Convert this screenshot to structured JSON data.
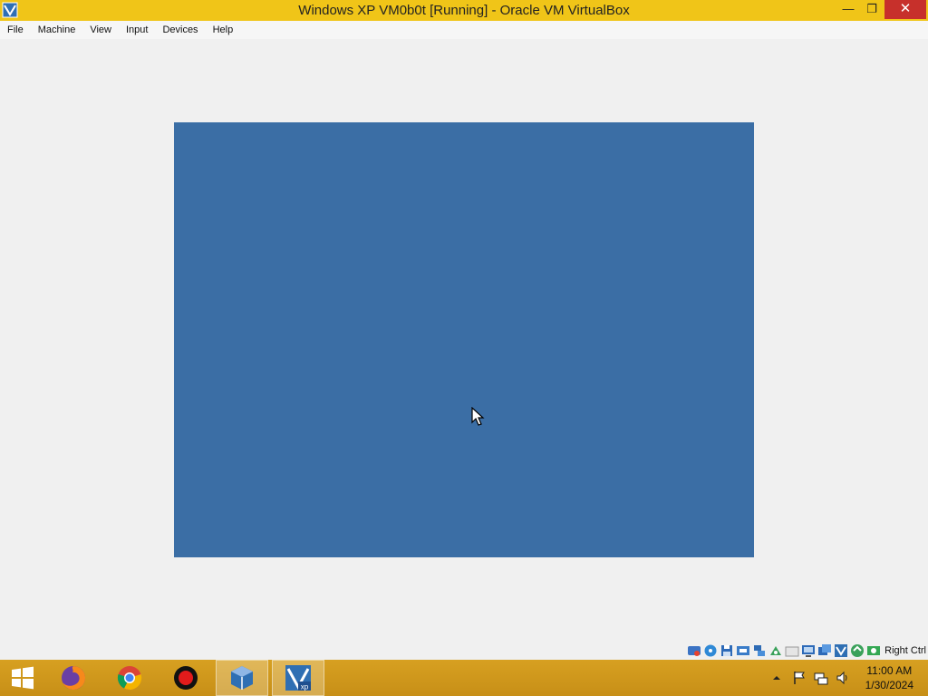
{
  "window": {
    "title": "Windows XP VM0b0t [Running] - Oracle VM VirtualBox",
    "minimize_glyph": "—",
    "restore_glyph": "❐",
    "close_glyph": "✕"
  },
  "menu": {
    "items": [
      "File",
      "Machine",
      "View",
      "Input",
      "Devices",
      "Help"
    ]
  },
  "vm": {
    "screen_color": "#3b6ea5"
  },
  "statusbar": {
    "icons": [
      "hard-disk-icon",
      "optical-drive-icon",
      "floppy-drive-icon",
      "audio-icon",
      "network-icon",
      "usb-icon",
      "shared-folders-icon",
      "display-icon",
      "video-capture-icon",
      "virtualization-icon",
      "mouse-integration-icon",
      "keyboard-icon"
    ],
    "host_key": "Right Ctrl"
  },
  "taskbar": {
    "apps": [
      "firefox-icon",
      "chrome-icon",
      "recorder-icon",
      "virtualbox-icon",
      "windows-xp-vm-icon"
    ],
    "active_app": "windows-xp-vm-icon",
    "clock": {
      "time": "11:00 AM",
      "date": "1/30/2024"
    }
  },
  "colors": {
    "titlebar": "#f0c518",
    "close": "#c7302b",
    "taskbar": "#cf9a1c",
    "vm_screen": "#3b6ea5"
  }
}
